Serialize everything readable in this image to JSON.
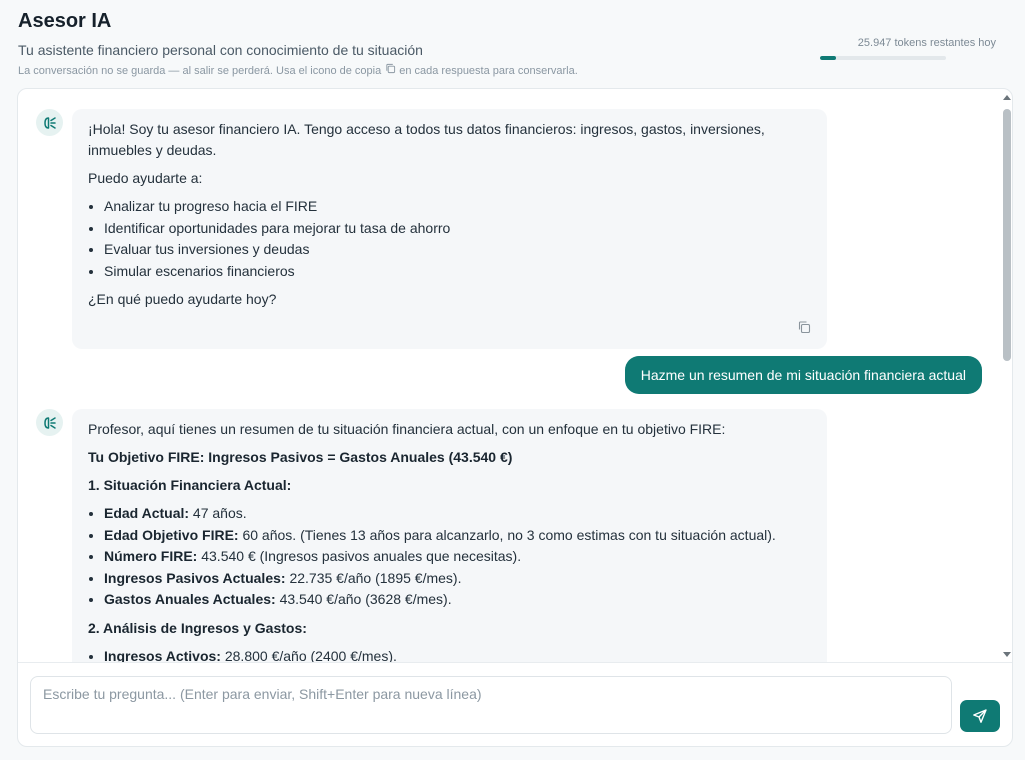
{
  "header": {
    "title": "Asesor IA",
    "subtitle": "Tu asistente financiero personal con conocimiento de tu situación",
    "notice_before": "La conversación no se guarda — al salir se perderá. Usa el icono de copia",
    "notice_after": "en cada respuesta para conservarla.",
    "tokens_text": "25.947 tokens restantes hoy",
    "tokens_fraction": 0.13
  },
  "messages": {
    "bot1": {
      "intro": "¡Hola! Soy tu asesor financiero IA. Tengo acceso a todos tus datos financieros: ingresos, gastos, inversiones, inmuebles y deudas.",
      "help_label": "Puedo ayudarte a:",
      "items": [
        "Analizar tu progreso hacia el FIRE",
        "Identificar oportunidades para mejorar tu tasa de ahorro",
        "Evaluar tus inversiones y deudas",
        "Simular escenarios financieros"
      ],
      "closing": "¿En qué puedo ayudarte hoy?"
    },
    "user1": "Hazme un resumen de mi situación financiera actual",
    "bot2": {
      "intro": "Profesor, aquí tienes un resumen de tu situación financiera actual, con un enfoque en tu objetivo FIRE:",
      "objective": "Tu Objetivo FIRE: Ingresos Pasivos = Gastos Anuales (43.540 €)",
      "section1": "1. Situación Financiera Actual:",
      "s1_items": [
        {
          "label": "Edad Actual:",
          "text": " 47 años."
        },
        {
          "label": "Edad Objetivo FIRE:",
          "text": " 60 años. (Tienes 13 años para alcanzarlo, no 3 como estimas con tu situación actual)."
        },
        {
          "label": "Número FIRE:",
          "text": " 43.540 € (Ingresos pasivos anuales que necesitas)."
        },
        {
          "label": "Ingresos Pasivos Actuales:",
          "text": " 22.735 €/año (1895 €/mes)."
        },
        {
          "label": "Gastos Anuales Actuales:",
          "text": " 43.540 €/año (3628 €/mes)."
        }
      ],
      "section2": "2. Análisis de Ingresos y Gastos:",
      "s2_items": [
        {
          "label": "Ingresos Activos:",
          "text": " 28.800 €/año (2400 €/mes)."
        }
      ]
    }
  },
  "input": {
    "placeholder": "Escribe tu pregunta... (Enter para enviar, Shift+Enter para nueva línea)"
  },
  "colors": {
    "accent": "#0f7a74"
  }
}
